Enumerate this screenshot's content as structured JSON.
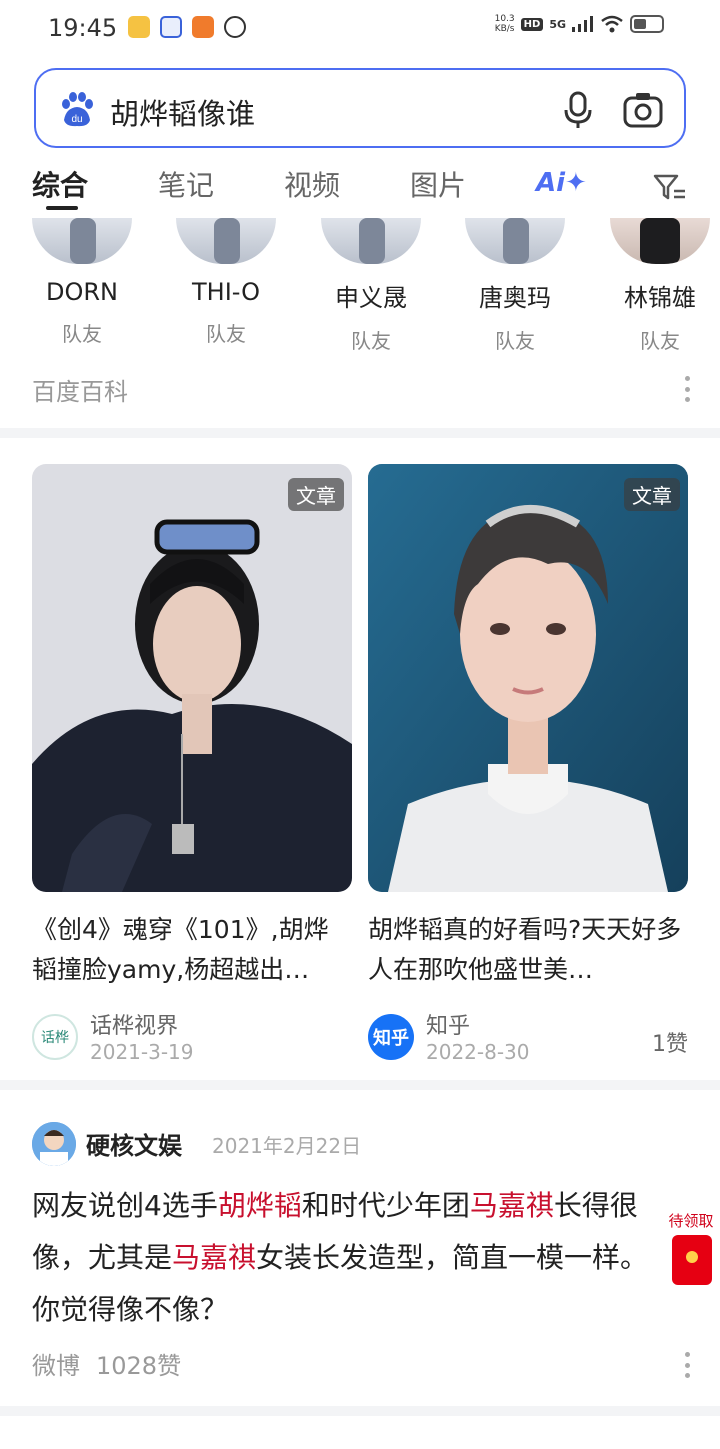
{
  "status_bar": {
    "time": "19:45",
    "net_speed_value": "10.3",
    "net_speed_unit": "KB/s",
    "hd": "HD",
    "signal": "5G"
  },
  "search": {
    "query": "胡烨韬像谁",
    "icons": [
      "baidu-paw-icon",
      "microphone-icon",
      "camera-icon"
    ]
  },
  "tabs": {
    "items": [
      "综合",
      "笔记",
      "视频",
      "图片"
    ],
    "ai_label": "Ai✦",
    "active": "综合"
  },
  "teammates": [
    {
      "name": "DORN",
      "role": "队友"
    },
    {
      "name": "THI-O",
      "role": "队友"
    },
    {
      "name": "申义晟",
      "role": "队友"
    },
    {
      "name": "唐奥玛",
      "role": "队友"
    },
    {
      "name": "林锦雄",
      "role": "队友"
    }
  ],
  "baike_source": "百度百科",
  "cards": [
    {
      "badge": "文章",
      "title": "《创4》魂穿《101》,胡烨韬撞脸yamy,杨超越出…",
      "source": "话桦视界",
      "date": "2021-3-19",
      "logo_text": "话桦",
      "likes": ""
    },
    {
      "badge": "文章",
      "title": "胡烨韬真的好看吗?天天好多人在那吹他盛世美…",
      "source": "知乎",
      "date": "2022-8-30",
      "logo_text": "知乎",
      "likes": "1赞"
    }
  ],
  "post": {
    "author": "硬核文娱",
    "date": "2021年2月22日",
    "body": [
      {
        "text": "网友说创4选手",
        "hl": false
      },
      {
        "text": "胡烨韬",
        "hl": true
      },
      {
        "text": "和时代少年团",
        "hl": false
      },
      {
        "text": "马嘉祺",
        "hl": true
      },
      {
        "text": "长得很像，尤其是",
        "hl": false
      },
      {
        "text": "马嘉祺",
        "hl": true
      },
      {
        "text": "女装长发造型，简直一模一样。你觉得像不像？",
        "hl": false
      }
    ],
    "source": "微博",
    "likes": "1028赞"
  },
  "red_packet": {
    "label": "待领取"
  },
  "colors": {
    "accent": "#4e6ef2",
    "highlight": "#c8102e",
    "muted": "#999999"
  }
}
